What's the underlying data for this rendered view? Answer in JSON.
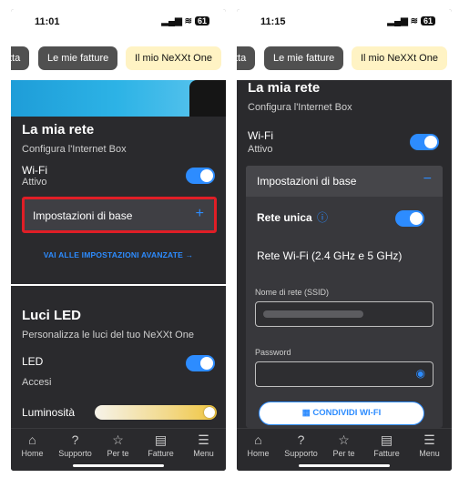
{
  "left": {
    "time": "11:01",
    "battery": "61",
    "tabs": [
      "tta",
      "Le mie fatture",
      "Il mio NeXXt One"
    ],
    "section_title": "La mia rete",
    "section_sub": "Configura l'Internet Box",
    "wifi_label": "Wi-Fi",
    "wifi_status": "Attivo",
    "accordion_label": "Impostazioni di base",
    "accordion_icon": "+",
    "advanced_link": "VAI ALLE IMPOSTAZIONI AVANZATE  →",
    "led_title": "Luci LED",
    "led_sub": "Personalizza le luci del tuo NeXXt One",
    "led_label": "LED",
    "led_status": "Accesi",
    "brightness_label": "Luminosità"
  },
  "right": {
    "time": "11:15",
    "battery": "61",
    "tabs": [
      "tta",
      "Le mie fatture",
      "Il mio NeXXt One"
    ],
    "section_title": "La mia rete",
    "section_sub": "Configura l'Internet Box",
    "wifi_label": "Wi-Fi",
    "wifi_status": "Attivo",
    "accordion_label": "Impostazioni di base",
    "accordion_icon": "−",
    "unique_net_label": "Rete unica",
    "unique_net_info": "ⓘ",
    "wifi_bands": "Rete Wi-Fi (2.4 GHz e 5 GHz)",
    "ssid_label": "Nome di rete (SSID)",
    "password_label": "Password",
    "share_button": "CONDIVIDI WI-FI"
  },
  "nav": [
    "Home",
    "Supporto",
    "Per te",
    "Fatture",
    "Menu"
  ],
  "nav_icons": [
    "home-icon",
    "support-icon",
    "star-icon",
    "invoice-icon",
    "menu-icon"
  ],
  "colors": {
    "accent": "#2d8cff",
    "bg": "#2a2a2d",
    "highlight": "#e01e26",
    "active_tab": "#fff3c4"
  }
}
